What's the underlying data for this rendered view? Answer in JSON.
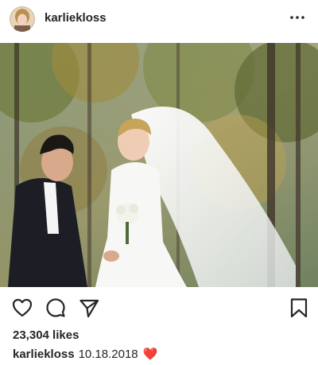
{
  "post": {
    "username": "karliekloss",
    "likes_text": "23,304 likes",
    "caption_user": "karliekloss",
    "caption_text": "10.18.2018",
    "caption_emoji": "❤️"
  },
  "icons": {
    "more": "more-options-icon",
    "like": "heart-icon",
    "comment": "comment-icon",
    "share": "share-icon",
    "save": "bookmark-icon"
  },
  "colors": {
    "text": "#262626",
    "heart_emoji": "#e0245e"
  }
}
